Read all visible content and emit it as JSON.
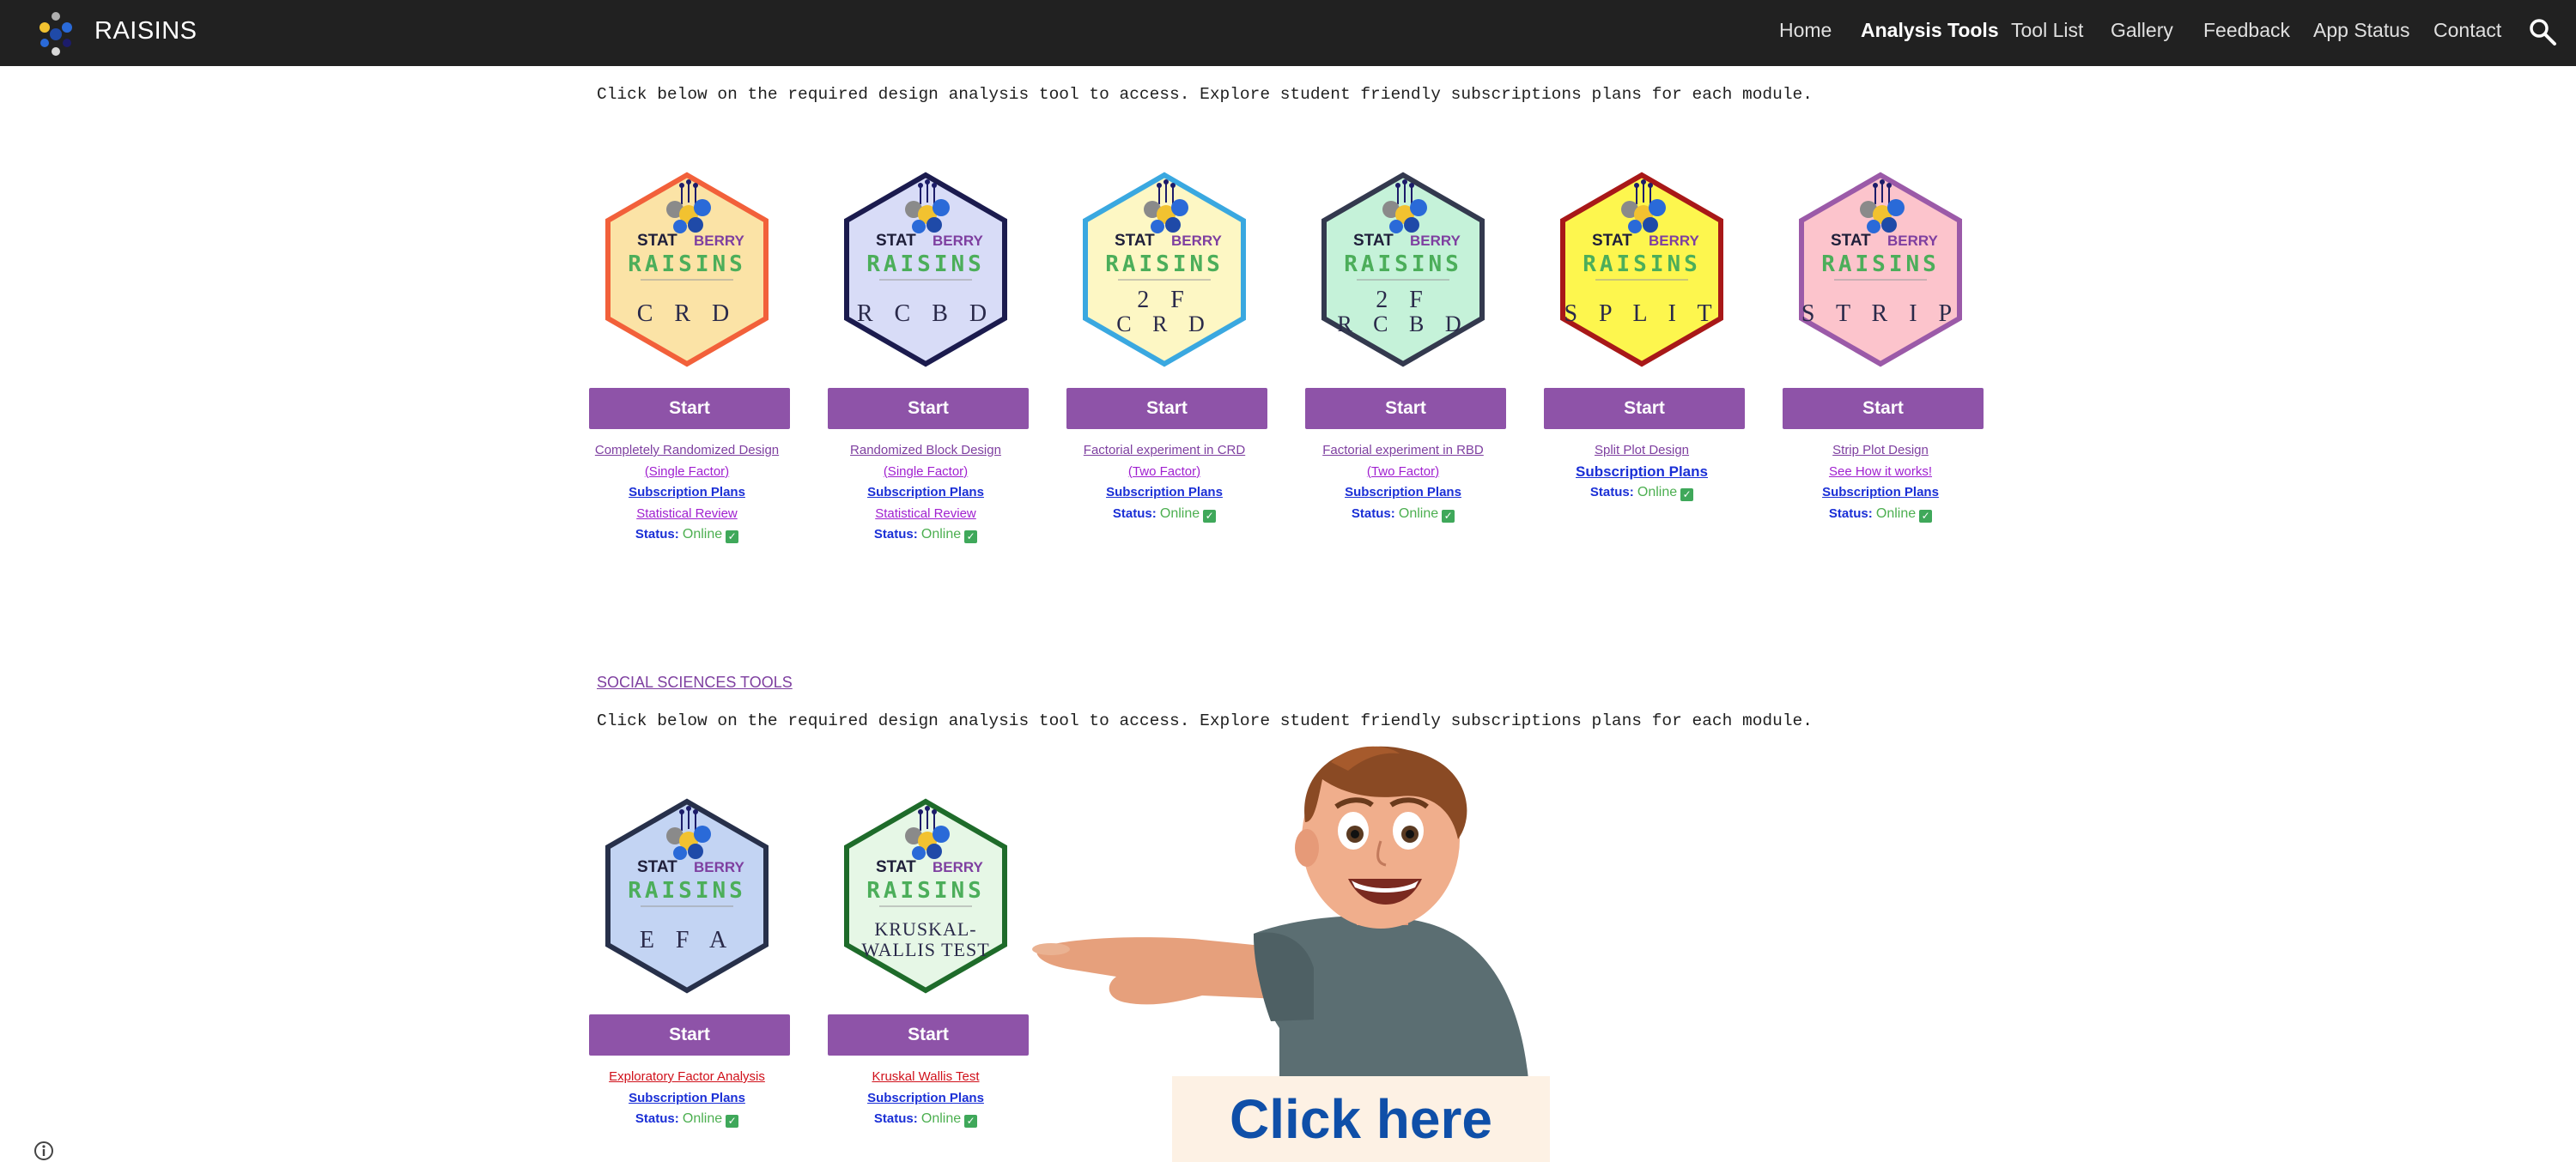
{
  "nav": {
    "brand": "RAISINS",
    "items": [
      {
        "label": "Home",
        "active": false
      },
      {
        "label": "Analysis Tools",
        "active": true
      },
      {
        "label": "Tool List",
        "active": false
      },
      {
        "label": "Gallery",
        "active": false
      },
      {
        "label": "Feedback",
        "active": false
      },
      {
        "label": "App Status",
        "active": false
      },
      {
        "label": "Contact",
        "active": false
      }
    ]
  },
  "intro_text": "Click below on the required design analysis tool to access. Explore student friendly subscriptions plans for each module.",
  "badge_text": {
    "brand_top": "STAT",
    "brand_bottom": "BERRY",
    "product": "RAISINS"
  },
  "tools": [
    {
      "code": "CRD",
      "hex_fill": "#fbe3a6",
      "hex_stroke": "#f2603a",
      "start_label": "Start",
      "links": [
        {
          "text": "Completely Randomized Design",
          "style": "purple"
        },
        {
          "text": "(Single Factor)",
          "style": "magenta"
        },
        {
          "text": "Subscription Plans",
          "style": "blue"
        },
        {
          "text": "Statistical Review",
          "style": "magenta"
        }
      ],
      "status_label": "Status:",
      "status_value": "Online"
    },
    {
      "code": "RCBD",
      "hex_fill": "#d8dcf7",
      "hex_stroke": "#1b1b4e",
      "start_label": "Start",
      "links": [
        {
          "text": "Randomized Block Design",
          "style": "purple"
        },
        {
          "text": "(Single Factor)",
          "style": "magenta"
        },
        {
          "text": "Subscription Plans",
          "style": "blue"
        },
        {
          "text": "Statistical Review",
          "style": "magenta"
        }
      ],
      "status_label": "Status:",
      "status_value": "Online"
    },
    {
      "code": "2F CRD",
      "hex_fill": "#fdf7c4",
      "hex_stroke": "#3aa8e0",
      "start_label": "Start",
      "links": [
        {
          "text": "Factorial experiment in CRD",
          "style": "purple"
        },
        {
          "text": "(Two Factor)",
          "style": "magenta"
        },
        {
          "text": "Subscription Plans",
          "style": "blue"
        }
      ],
      "status_label": "Status:",
      "status_value": "Online"
    },
    {
      "code": "2F RCBD",
      "hex_fill": "#c5f2d9",
      "hex_stroke": "#33394e",
      "start_label": "Start",
      "links": [
        {
          "text": "Factorial experiment in RBD",
          "style": "purple"
        },
        {
          "text": "(Two Factor)",
          "style": "magenta"
        },
        {
          "text": "Subscription Plans",
          "style": "blue"
        }
      ],
      "status_label": "Status:",
      "status_value": "Online"
    },
    {
      "code": "SPLIT",
      "hex_fill": "#fdf64e",
      "hex_stroke": "#a81818",
      "start_label": "Start",
      "links": [
        {
          "text": "Split Plot Design",
          "style": "purple"
        },
        {
          "text": "Subscription Plans",
          "style": "blue-lg"
        }
      ],
      "status_label": "Status:",
      "status_value": "Online"
    },
    {
      "code": "STRIP",
      "hex_fill": "#fcc4cc",
      "hex_stroke": "#9b5aa8",
      "start_label": "Start",
      "links": [
        {
          "text": "Strip Plot Design",
          "style": "purple"
        },
        {
          "text": "See How it works!",
          "style": "magenta"
        },
        {
          "text": "Subscription Plans",
          "style": "blue"
        }
      ],
      "status_label": "Status:",
      "status_value": "Online"
    }
  ],
  "social": {
    "heading": "SOCIAL SCIENCES TOOLS",
    "intro_text": "Click below on the required design analysis tool to access. Explore student friendly subscriptions plans for each module.",
    "tools": [
      {
        "code": "EFA",
        "hex_fill": "#c3d4f3",
        "hex_stroke": "#27304a",
        "start_label": "Start",
        "links": [
          {
            "text": "Exploratory Factor Analysis",
            "style": "red"
          },
          {
            "text": "Subscription Plans",
            "style": "blue"
          }
        ],
        "status_label": "Status:",
        "status_value": "Online"
      },
      {
        "code": "KRUSKAL-WALLIS TEST",
        "hex_fill": "#e6f7e6",
        "hex_stroke": "#1e6b2a",
        "start_label": "Start",
        "links": [
          {
            "text": "Kruskal Wallis Test",
            "style": "red"
          },
          {
            "text": "Subscription Plans",
            "style": "blue"
          }
        ],
        "status_label": "Status:",
        "status_value": "Online"
      }
    ]
  },
  "promo": {
    "cta": "Click here"
  }
}
